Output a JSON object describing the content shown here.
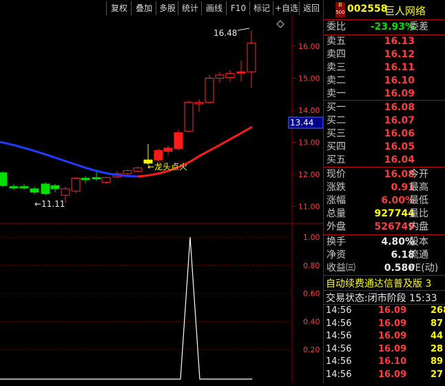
{
  "toolbar": {
    "items": [
      "复权",
      "叠加",
      "多股",
      "统计",
      "画线",
      "F10",
      "标记",
      "+自选",
      "返回"
    ]
  },
  "main_chart": {
    "price_ticks": [
      "16.00",
      "15.00",
      "14.00",
      "13.00",
      "12.00",
      "11.00"
    ],
    "current_price_tag": "13.44",
    "high_annotation": "16.48",
    "low_annotation": "←11.11",
    "signal_annotation": "←龙头点火"
  },
  "indicator_chart": {
    "ticks": [
      "1.00",
      "0.80",
      "0.60",
      "0.40",
      "0.20"
    ]
  },
  "quote": {
    "r_badge": "R",
    "market_badge": "500",
    "code": "002558",
    "name": "巨人网络",
    "weibi_label": "委比",
    "weibi_value": "-23.93%",
    "weicha_label": "委差",
    "asks": [
      {
        "label": "卖五",
        "price": "16.13"
      },
      {
        "label": "卖四",
        "price": "16.12"
      },
      {
        "label": "卖三",
        "price": "16.11"
      },
      {
        "label": "卖二",
        "price": "16.10"
      },
      {
        "label": "卖一",
        "price": "16.09"
      }
    ],
    "bids": [
      {
        "label": "买一",
        "price": "16.08"
      },
      {
        "label": "买二",
        "price": "16.07"
      },
      {
        "label": "买三",
        "price": "16.06"
      },
      {
        "label": "买四",
        "price": "16.05"
      },
      {
        "label": "买五",
        "price": "16.04"
      }
    ],
    "stats": [
      {
        "label": "现价",
        "value": "16.08",
        "label2": "今开",
        "color": "red"
      },
      {
        "label": "涨跌",
        "value": "0.91",
        "label2": "最高",
        "color": "red"
      },
      {
        "label": "涨幅",
        "value": "6.00%",
        "label2": "最低",
        "color": "red"
      },
      {
        "label": "总量",
        "value": "927744",
        "label2": "量比",
        "color": "yellow"
      },
      {
        "label": "外盘",
        "value": "526749",
        "label2": "内盘",
        "color": "red"
      }
    ],
    "stats2": [
      {
        "label": "换手",
        "value": "4.80%",
        "label2": "股本"
      },
      {
        "label": "净资",
        "value": "6.18",
        "label2": "流通"
      },
      {
        "label": "收益㈢",
        "value": "0.580",
        "label2": "PE(动)"
      }
    ],
    "ticker_text": "自动续费通达信普及版 3",
    "status_label": "交易状态:",
    "status_value": "闭市阶段 15:33",
    "trades": [
      {
        "time": "14:56",
        "price": "16.09",
        "vol": "268"
      },
      {
        "time": "14:56",
        "price": "16.09",
        "vol": "87"
      },
      {
        "time": "14:56",
        "price": "16.09",
        "vol": "44"
      },
      {
        "time": "14:56",
        "price": "16.09",
        "vol": "28"
      },
      {
        "time": "14:56",
        "price": "16.10",
        "vol": "89"
      },
      {
        "time": "14:56",
        "price": "16.09",
        "vol": "27"
      }
    ]
  },
  "colors": {
    "up": "#ff2a2a",
    "down": "#00e000",
    "doji": "#ffff00",
    "ma_blue": "#1f3cff",
    "ma_red": "#ff1a1a",
    "grid": "#8b0000"
  }
}
